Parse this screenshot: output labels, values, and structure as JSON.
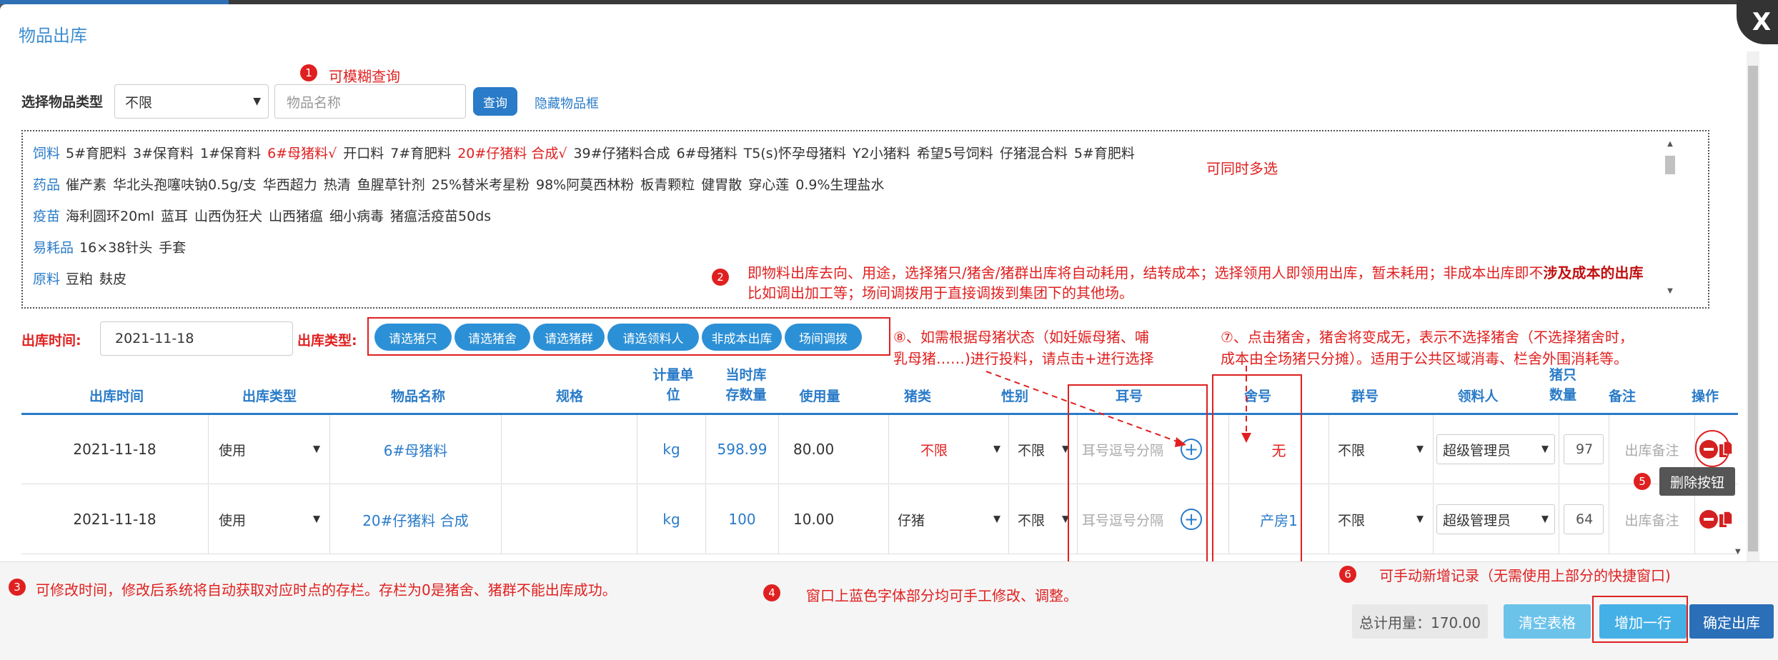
{
  "dialog": {
    "title": "物品出库",
    "close_label": "X"
  },
  "search": {
    "type_label": "选择物品类型",
    "type_value": "不限",
    "name_placeholder": "物品名称",
    "query_label": "查询",
    "hide_label": "隐藏物品框"
  },
  "items": [
    {
      "category": "饲料",
      "entries": [
        {
          "text": "5#育肥料",
          "selected": false
        },
        {
          "text": "3#保育料",
          "selected": false
        },
        {
          "text": "1#保育料",
          "selected": false
        },
        {
          "text": "6#母猪料√",
          "selected": true
        },
        {
          "text": "开口料",
          "selected": false
        },
        {
          "text": "7#育肥料",
          "selected": false
        },
        {
          "text": "20#仔猪料 合成√",
          "selected": true
        },
        {
          "text": "39#仔猪料合成",
          "selected": false
        },
        {
          "text": "6#母猪料",
          "selected": false
        },
        {
          "text": "T5(s)怀孕母猪料",
          "selected": false
        },
        {
          "text": "Y2小猪料",
          "selected": false
        },
        {
          "text": "希望5号饲料",
          "selected": false
        },
        {
          "text": "仔猪混合料",
          "selected": false
        },
        {
          "text": "5#育肥料",
          "selected": false
        }
      ]
    },
    {
      "category": "药品",
      "entries": [
        {
          "text": "催产素",
          "selected": false
        },
        {
          "text": "华北头孢噻呋钠0.5g/支",
          "selected": false
        },
        {
          "text": "华西超力",
          "selected": false
        },
        {
          "text": "热清",
          "selected": false
        },
        {
          "text": "鱼腥草针剂",
          "selected": false
        },
        {
          "text": "25%替米考星粉",
          "selected": false
        },
        {
          "text": "98%阿莫西林粉",
          "selected": false
        },
        {
          "text": "板青颗粒",
          "selected": false
        },
        {
          "text": "健胃散",
          "selected": false
        },
        {
          "text": "穿心莲",
          "selected": false
        },
        {
          "text": "0.9%生理盐水",
          "selected": false
        }
      ]
    },
    {
      "category": "疫苗",
      "entries": [
        {
          "text": "海利圆环20ml",
          "selected": false
        },
        {
          "text": "蓝耳",
          "selected": false
        },
        {
          "text": "山西伪狂犬",
          "selected": false
        },
        {
          "text": "山西猪瘟",
          "selected": false
        },
        {
          "text": "细小病毒",
          "selected": false
        },
        {
          "text": "猪瘟活疫苗50ds",
          "selected": false
        }
      ]
    },
    {
      "category": "易耗品",
      "entries": [
        {
          "text": "16×38针头",
          "selected": false
        },
        {
          "text": "手套",
          "selected": false
        }
      ]
    },
    {
      "category": "原料",
      "entries": [
        {
          "text": "豆粕",
          "selected": false
        },
        {
          "text": "麸皮",
          "selected": false
        }
      ]
    }
  ],
  "outbound": {
    "time_label": "出库时间:",
    "time_value": "2021-11-18",
    "type_label": "出库类型:",
    "type_buttons": [
      "请选猪只",
      "请选猪舍",
      "请选猪群",
      "请选领料人",
      "非成本出库",
      "场间调拨"
    ]
  },
  "annotations": {
    "n1": {
      "num": "1",
      "text": "可模糊查询"
    },
    "multi": "可同时多选",
    "n2": {
      "num": "2",
      "line1_a": "即物料出库去向、用途，选择猪只/猪舍/猪群出库将自动耗用，结转成本；选择领用人即领用出库，暂未耗用；非成本出库即不",
      "line1_b": "涉及成本的出库",
      "line2": "比如调出加工等；场间调拨用于直接调拨到集团下的其他场。"
    },
    "n8": {
      "line1": "⑧、如需根据母猪状态（如妊娠母猪、哺",
      "line2": "乳母猪……)进行投料，请点击+进行选择"
    },
    "n7": {
      "line1": "⑦、点击猪舍，猪舍将变成无，表示不选择猪舍（不选择猪舍时，",
      "line2": "成本由全场猪只分摊）。适用于公共区域消毒、栏舍外围消耗等。"
    },
    "n5": {
      "num": "5",
      "tooltip": "删除按钮"
    },
    "n3": {
      "num": "3",
      "text": "可修改时间，修改后系统将自动获取对应时点的存栏。存栏为0是猪舍、猪群不能出库成功。"
    },
    "n4": {
      "num": "4",
      "text": "窗口上蓝色字体部分均可手工修改、调整。"
    },
    "n6": {
      "num": "6",
      "text": "可手动新增记录（无需使用上部分的快捷窗口)"
    }
  },
  "table": {
    "headers": {
      "time": "出库时间",
      "type": "出库类型",
      "name": "物品名称",
      "spec": "规格",
      "unit_1": "计量单",
      "unit_2": "位",
      "stock_1": "当时库",
      "stock_2": "存数量",
      "usage": "使用量",
      "pig_type": "猪类",
      "gender": "性别",
      "ear_tag": "耳号",
      "house": "舍号",
      "group": "群号",
      "receiver": "领料人",
      "count_1": "猪只",
      "count_2": "数量",
      "remark": "备注",
      "action": "操作"
    },
    "rows": [
      {
        "time": "2021-11-18",
        "type": "使用",
        "name": "6#母猪料",
        "spec": "",
        "unit": "kg",
        "stock": "598.99",
        "usage": "80.00",
        "pig_type": "不限",
        "gender": "不限",
        "ear_placeholder": "耳号逗号分隔",
        "house": "无",
        "group": "不限",
        "receiver": "超级管理员",
        "count": "97",
        "remark_placeholder": "出库备注"
      },
      {
        "time": "2021-11-18",
        "type": "使用",
        "name": "20#仔猪料 合成",
        "spec": "",
        "unit": "kg",
        "stock": "100",
        "usage": "10.00",
        "pig_type": "仔猪",
        "gender": "不限",
        "ear_placeholder": "耳号逗号分隔",
        "house": "产房1",
        "group": "不限",
        "receiver": "超级管理员",
        "count": "64",
        "remark_placeholder": "出库备注"
      }
    ]
  },
  "footer": {
    "total": "总计用量：170.00",
    "clear": "清空表格",
    "add_row": "增加一行",
    "confirm": "确定出库"
  },
  "colors": {
    "accent": "#2c90d6",
    "annotation": "#e02020",
    "text_blue": "#2a7bc8"
  }
}
